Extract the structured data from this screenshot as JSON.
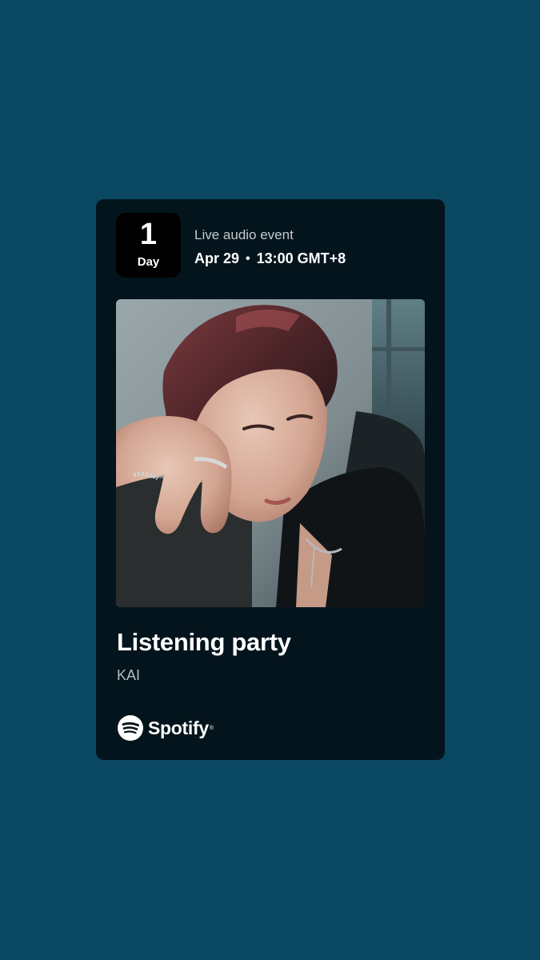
{
  "colors": {
    "background": "#0a4862",
    "card": "#03141c",
    "badge": "#000000",
    "text_primary": "#ffffff",
    "text_secondary": "#b5bcbf"
  },
  "countdown": {
    "number": "1",
    "unit": "Day"
  },
  "event": {
    "type": "Live audio event",
    "date": "Apr 29",
    "separator": "•",
    "time": "13:00 GMT+8"
  },
  "artwork": {
    "icon": "artist-portrait-photo"
  },
  "title": "Listening party",
  "artist": "KAI",
  "brand": {
    "name": "Spotify",
    "trademark": "®",
    "icon": "spotify-logo-icon"
  }
}
